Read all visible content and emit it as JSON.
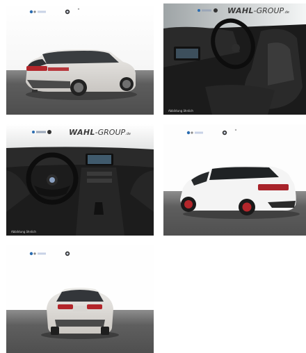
{
  "gallery": {
    "tiles": [
      {
        "alt": "BMW X1 exterior rear three-quarter view, silver",
        "caption": ""
      },
      {
        "alt": "BMW X1 interior, driver seat and steering wheel",
        "caption": "Abbildung ähnlich"
      },
      {
        "alt": "BMW X1 dashboard and center console",
        "caption": "Abbildung ähnlich"
      },
      {
        "alt": "BMW X3 exterior rear three-quarter view, white",
        "caption": ""
      },
      {
        "alt": "BMW X1 exterior rear view, silver",
        "caption": ""
      }
    ],
    "dealer_logo": {
      "brand": "WAHL",
      "suffix": "-GROUP",
      "tld": ".de"
    }
  },
  "colors": {
    "studio_floor": "#5b5b5b",
    "car_silver": "#dcd9d5",
    "car_white": "#f4f4f4",
    "taillight": "#b3262b",
    "interior_dark": "#1e1e1e"
  }
}
